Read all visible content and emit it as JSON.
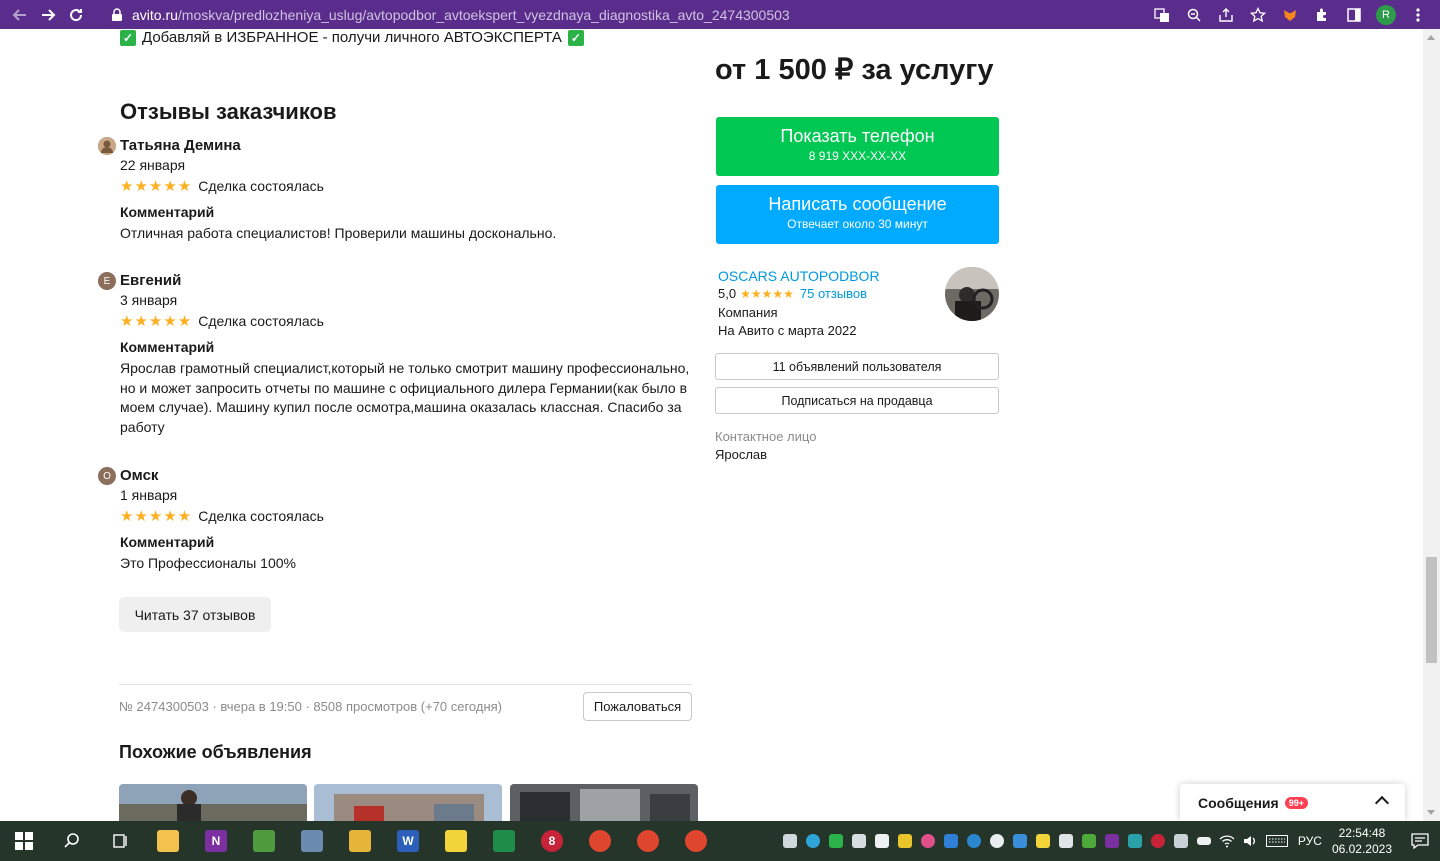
{
  "browser": {
    "url_host": "avito.ru",
    "url_path": "/moskva/predlozheniya_uslug/avtopodbor_avtoekspert_vyezdnaya_diagnostika_avto_2474300503",
    "profile_initial": "R"
  },
  "promo": {
    "text": "Добавляй в ИЗБРАННОЕ - получи личного АВТОЭКСПЕРТА"
  },
  "reviews": {
    "title": "Отзывы заказчиков",
    "comment_label": "Комментарий",
    "status": "Сделка состоялась",
    "stars": "★★★★★",
    "items": [
      {
        "author": "Татьяна Демина",
        "date": "22 января",
        "avatar_initial": "",
        "comment": "Отличная работа специалистов! Проверили машины досконально."
      },
      {
        "author": "Евгений",
        "date": "3 января",
        "avatar_initial": "Е",
        "comment": "Ярослав грамотный специалист,который не только смотрит машину профессионально, но и может запросить отчеты по машине с официального дилера Германии(как было в моем случае). Машину купил после осмотра,машина оказалась классная. Спасибо за работу"
      },
      {
        "author": "Омск",
        "date": "1 января",
        "avatar_initial": "О",
        "comment": "Это Профессионалы 100%"
      }
    ],
    "read_more_label": "Читать 37 отзывов"
  },
  "ad_meta": {
    "text": "№ 2474300503 · вчера в 19:50 · 8508 просмотров (+70 сегодня)",
    "complain_label": "Пожаловаться"
  },
  "similar": {
    "title": "Похожие объявления"
  },
  "sidebar": {
    "price": "от 1 500 ₽ за услугу",
    "phone_button": {
      "label": "Показать телефон",
      "sub": "8 919 XXX-XX-XX"
    },
    "message_button": {
      "label": "Написать сообщение",
      "sub": "Отвечает около 30 минут"
    },
    "seller": {
      "name": "OSCARS AUTOPODBOR",
      "rating": "5,0",
      "stars": "★★★★★",
      "reviews_link": "75 отзывов",
      "type": "Компания",
      "since": "На Авито с марта 2022"
    },
    "ads_button": "11 объявлений пользователя",
    "subscribe_button": "Подписаться на продавца",
    "contact_label": "Контактное лицо",
    "contact_name": "Ярослав"
  },
  "messages_widget": {
    "label": "Сообщения",
    "badge": "99+"
  },
  "taskbar": {
    "language": "РУС",
    "time": "22:54:48",
    "date": "06.02.2023"
  },
  "colors": {
    "browser_bar": "#5a2d8c",
    "phone_button": "#00c853",
    "message_button": "#00aaff",
    "link": "#0099e0",
    "star": "#ffb021"
  }
}
